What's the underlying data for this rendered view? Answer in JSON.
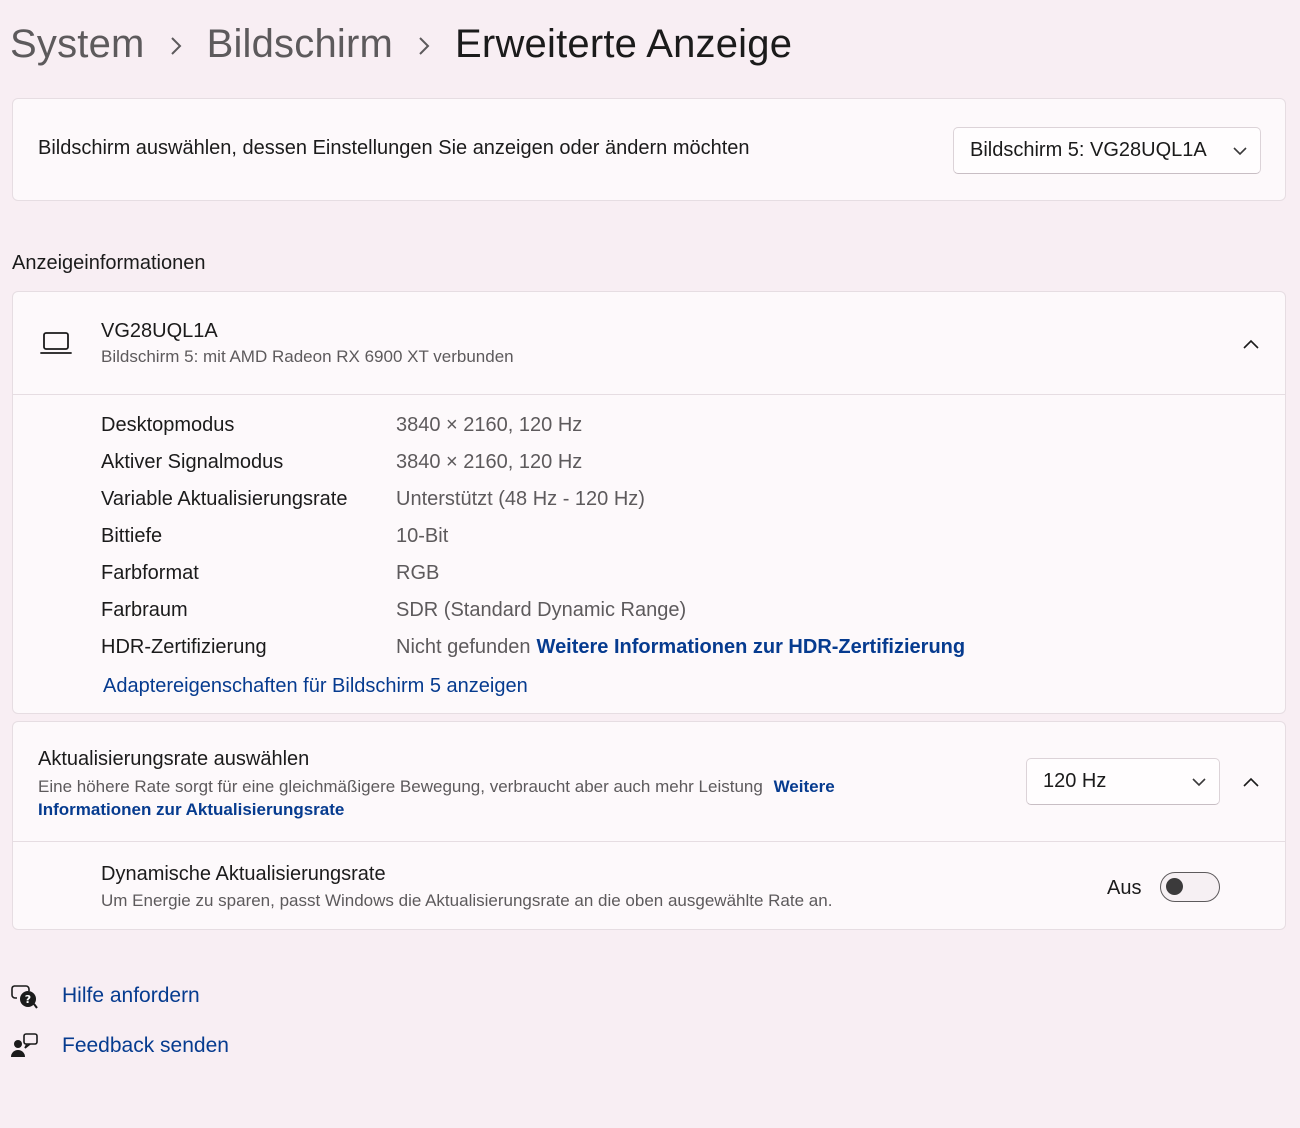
{
  "breadcrumb": {
    "items": [
      "System",
      "Bildschirm"
    ],
    "current": "Erweiterte Anzeige"
  },
  "display_select": {
    "label": "Bildschirm auswählen, dessen Einstellungen Sie anzeigen oder ändern möchten",
    "value": "Bildschirm 5: VG28UQL1A"
  },
  "info_section": {
    "title": "Anzeigeinformationen",
    "monitor_name": "VG28UQL1A",
    "monitor_sub": "Bildschirm 5: mit AMD Radeon RX 6900 XT verbunden",
    "rows": [
      {
        "label": "Desktopmodus",
        "value": "3840 × 2160, 120 Hz"
      },
      {
        "label": "Aktiver Signalmodus",
        "value": "3840 × 2160, 120 Hz"
      },
      {
        "label": "Variable Aktualisierungsrate",
        "value": "Unterstützt (48 Hz - 120 Hz)"
      },
      {
        "label": "Bittiefe",
        "value": "10-Bit"
      },
      {
        "label": "Farbformat",
        "value": "RGB"
      },
      {
        "label": "Farbraum",
        "value": "SDR (Standard Dynamic Range)"
      }
    ],
    "hdr": {
      "label": "HDR-Zertifizierung",
      "value": "Nicht gefunden",
      "link": "Weitere Informationen zur HDR-Zertifizierung"
    },
    "adapter_link": "Adaptereigenschaften für Bildschirm 5 anzeigen"
  },
  "refresh": {
    "title": "Aktualisierungsrate auswählen",
    "desc": "Eine höhere Rate sorgt für eine gleichmäßigere Bewegung, verbraucht aber auch mehr Leistung",
    "link_part1": "Weitere",
    "link_part2": "Informationen zur Aktualisierungsrate",
    "value": "120 Hz"
  },
  "dynamic_refresh": {
    "title": "Dynamische Aktualisierungsrate",
    "desc": "Um Energie zu sparen, passt Windows die Aktualisierungsrate an die oben ausgewählte Rate an.",
    "state_label": "Aus",
    "enabled": false
  },
  "footer": {
    "help": "Hilfe anfordern",
    "feedback": "Feedback senden"
  },
  "icons": {
    "breadcrumb_separator": "chevron-right-icon",
    "dropdown": "chevron-down-icon",
    "collapse": "chevron-up-icon",
    "monitor": "laptop-icon",
    "help": "help-chat-icon",
    "feedback": "feedback-person-icon"
  },
  "colors": {
    "background": "#f8eef3",
    "card": "#fdf9fb",
    "link": "#063b8f",
    "muted_text": "#5d5a5c"
  }
}
